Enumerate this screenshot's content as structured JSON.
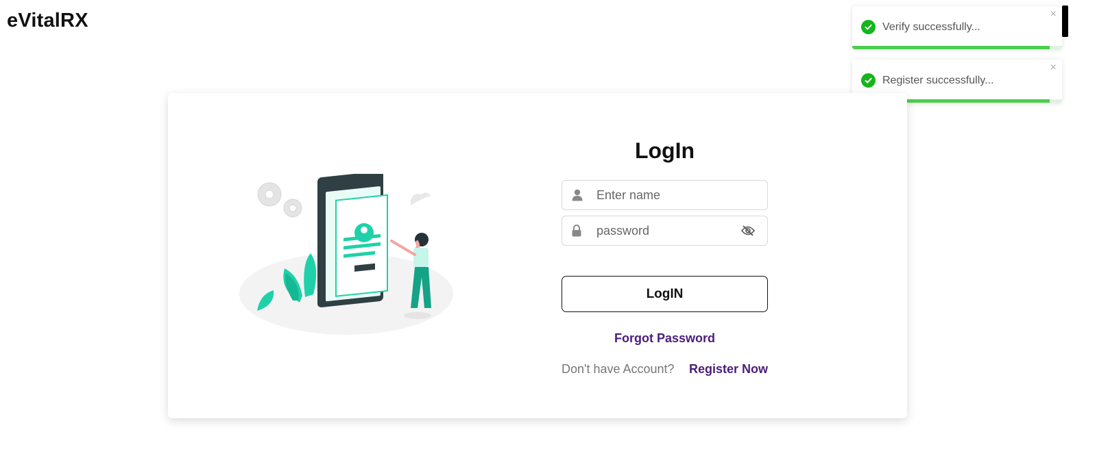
{
  "app": {
    "brand": "eVitalRX"
  },
  "toasts": [
    {
      "message": "Verify successfully...",
      "close": "×",
      "progress": 0.94
    },
    {
      "message": "Register successfully...",
      "close": "×",
      "progress": 0.94
    }
  ],
  "login": {
    "title": "LogIn",
    "name_field": {
      "value": "",
      "placeholder": "Enter name",
      "icon": "user-icon"
    },
    "password_field": {
      "value": "",
      "placeholder": "password",
      "icon": "lock-icon",
      "toggle_icon": "eye-slash-icon"
    },
    "submit_label": "LogIN",
    "forgot_label": "Forgot Password",
    "register_prompt": "Don't have Account?",
    "register_link": "Register Now"
  },
  "colors": {
    "accent": "#4a1d7a",
    "success": "#16b51c",
    "illustration_primary": "#1fd1a8",
    "phone_dark": "#2f3f44"
  }
}
